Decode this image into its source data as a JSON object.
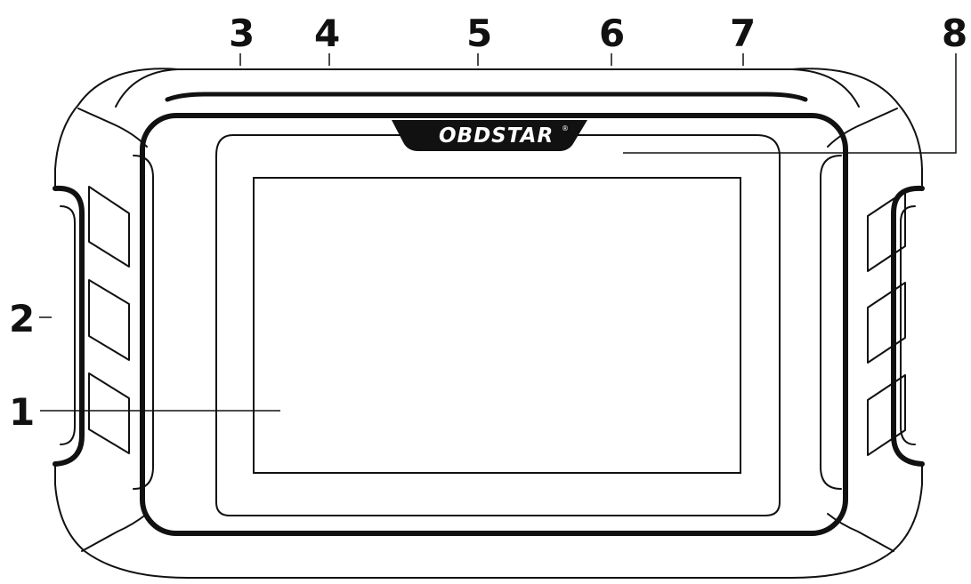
{
  "brand": {
    "logo_text": "OBDSTAR",
    "registered_mark": "®"
  },
  "callouts": [
    {
      "id": "1",
      "label": "1"
    },
    {
      "id": "2",
      "label": "2"
    },
    {
      "id": "3",
      "label": "3"
    },
    {
      "id": "4",
      "label": "4"
    },
    {
      "id": "5",
      "label": "5"
    },
    {
      "id": "6",
      "label": "6"
    },
    {
      "id": "7",
      "label": "7"
    },
    {
      "id": "8",
      "label": "8"
    }
  ],
  "colors": {
    "stroke": "#111111",
    "background": "#ffffff"
  }
}
